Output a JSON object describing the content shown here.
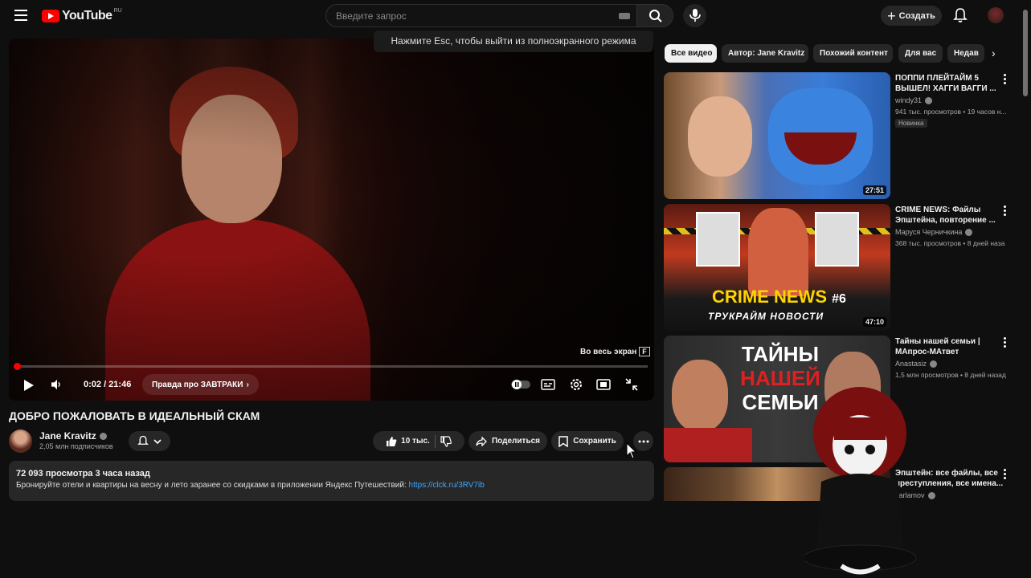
{
  "header": {
    "logo_text": "YouTube",
    "logo_region": "RU",
    "search_placeholder": "Введите запрос",
    "create_label": "Создать"
  },
  "player": {
    "esc_tip": "Нажмите Esc, чтобы выйти из полноэкранного режима",
    "fullscreen_hint": "Во весь экран",
    "fullscreen_key": "F",
    "time": "0:02 / 21:46",
    "chapter": "Правда про ЗАВТРАКИ",
    "progress": 0.0015
  },
  "video": {
    "title": "ДОБРО ПОЖАЛОВАТЬ В ИДЕАЛЬНЫЙ СКАМ",
    "channel": "Jane Kravitz",
    "subscribers": "2,05 млн подписчиков",
    "likes": "10 тыс.",
    "share": "Поделиться",
    "save": "Сохранить"
  },
  "description": {
    "meta": "72 093 просмотра  3 часа назад",
    "text": "Бронируйте отели и квартиры на весну и лето заранее со скидками в приложении Яндекс Путешествий: ",
    "link": "https://clck.ru/3RV7ib"
  },
  "chips": [
    "Все видео",
    "Автор: Jane Kravitz",
    "Похожий контент",
    "Для вас",
    "Недав"
  ],
  "recommendations": [
    {
      "title": "ПОППИ ПЛЕЙТАЙМ 5 ВЫШЕЛ! ХАГГИ ВАГГИ ...",
      "channel": "windy31",
      "meta": "941 тыс. просмотров • 19 часов н...",
      "badge": "Новинка",
      "duration": "27:51"
    },
    {
      "title": "CRIME NEWS: Файлы Эпштейна, повторение ...",
      "channel": "Маруся Черничкина",
      "meta": "368 тыс. просмотров • 8 дней наза",
      "badge": "",
      "duration": "47:10",
      "thumb_text": "CRIME NEWS",
      "thumb_sub": "ТРУКРАЙМ НОВОСТИ",
      "thumb_num": "#6"
    },
    {
      "title": "Тайны нашей семьи | МАпрос-МАтвет",
      "channel": "Anastasiz",
      "meta": "1,5 млн просмотров • 8 дней назад",
      "badge": "",
      "duration": "",
      "thumb_lines": [
        "ТАЙНЫ",
        "НАШЕЙ",
        "СЕМЬИ"
      ]
    },
    {
      "title": "Эпштейн: все файлы, все преступления, все имена...",
      "channel": "varlamov",
      "meta": "",
      "badge": "",
      "duration": ""
    }
  ]
}
